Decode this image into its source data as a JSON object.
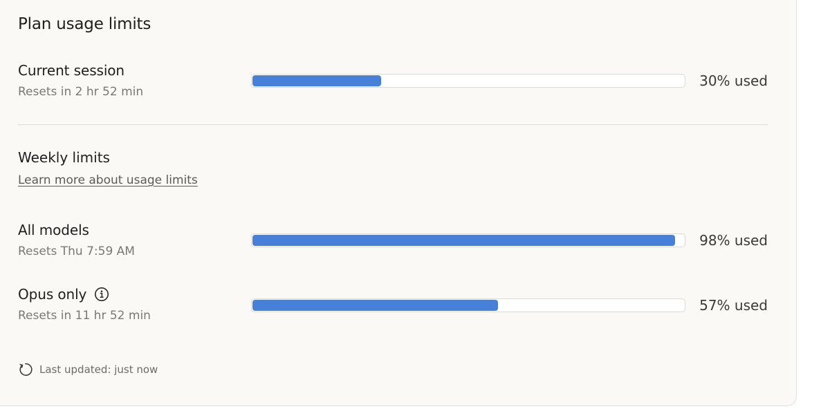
{
  "title": "Plan usage limits",
  "current_session": {
    "label": "Current session",
    "reset": "Resets in 2 hr 52 min",
    "percent": 30,
    "percent_label": "30% used"
  },
  "weekly": {
    "title": "Weekly limits",
    "learn_more": "Learn more about usage limits"
  },
  "all_models": {
    "label": "All models",
    "reset": "Resets Thu 7:59 AM",
    "percent": 98,
    "percent_label": "98% used"
  },
  "opus_only": {
    "label": "Opus only",
    "reset": "Resets in 11 hr 52 min",
    "percent": 57,
    "percent_label": "57% used"
  },
  "footer": {
    "last_updated": "Last updated: just now"
  },
  "colors": {
    "bar_fill": "#4680d8",
    "card_bg": "#faf9f6"
  },
  "icons": {
    "info": "info-icon",
    "refresh": "refresh-icon"
  }
}
